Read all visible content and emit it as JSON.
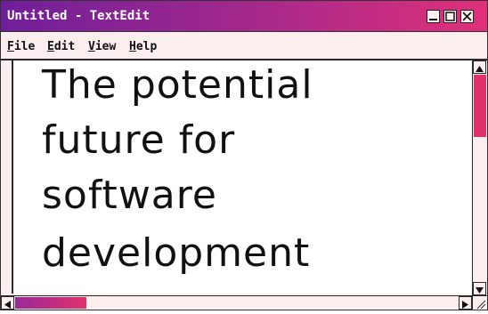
{
  "window": {
    "title": "Untitled - TextEdit",
    "buttons": {
      "minimize": "minimize-icon",
      "maximize": "maximize-icon",
      "close": "close-icon"
    }
  },
  "menu": {
    "items": [
      {
        "label": "File"
      },
      {
        "label": "Edit"
      },
      {
        "label": "View"
      },
      {
        "label": "Help"
      }
    ]
  },
  "document": {
    "lines": [
      "The potential",
      "future for",
      "software",
      "development"
    ]
  },
  "colors": {
    "titlebar_start": "#6f1f9a",
    "titlebar_end": "#e0307a",
    "accent": "#e0306a",
    "background": "#fbeeee"
  }
}
